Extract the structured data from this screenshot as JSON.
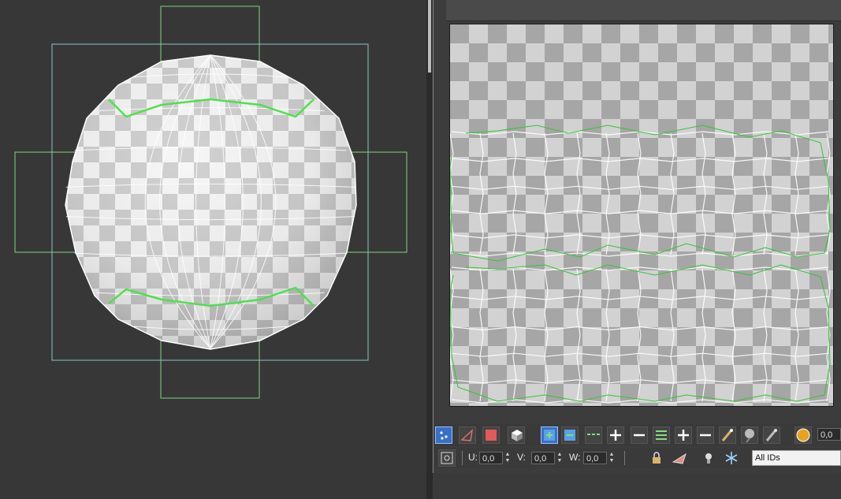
{
  "colors": {
    "viewport_bg": "#373737",
    "gizmo_green": "#7fd67f",
    "gizmo_cyan": "#86c7c2",
    "seam_green": "#4fe04f",
    "uv_seam": "#33c533",
    "mesh_white": "#ffffff",
    "checker_light": "#d2d2d2",
    "checker_dark": "#a6a6a6",
    "accent_blue": "#3b6fc7"
  },
  "toolbar": {
    "buttons": [
      {
        "icon": "move-vertex-icon",
        "active": true
      },
      {
        "icon": "edge-select-icon"
      },
      {
        "icon": "face-select-icon"
      },
      {
        "icon": "element-select-icon"
      },
      {
        "icon": "grow-selection-icon",
        "active": true
      },
      {
        "icon": "shrink-selection-icon"
      },
      {
        "icon": "loop-icon"
      },
      {
        "icon": "loop-grow-icon"
      },
      {
        "icon": "loop-shrink-icon"
      },
      {
        "icon": "ring-icon"
      },
      {
        "icon": "ring-grow-icon"
      },
      {
        "icon": "ring-shrink-icon"
      },
      {
        "icon": "paint-select-icon"
      },
      {
        "icon": "paint-grow-icon"
      },
      {
        "icon": "paint-shrink-icon"
      },
      {
        "icon": "soft-selection-icon"
      }
    ],
    "soft_value": "0,0"
  },
  "coords": {
    "u_label": "U:",
    "u_value": "0,0",
    "v_label": "V:",
    "v_value": "0,0",
    "w_label": "W:",
    "w_value": "0,0"
  },
  "id_filter": {
    "selected": "All IDs"
  }
}
